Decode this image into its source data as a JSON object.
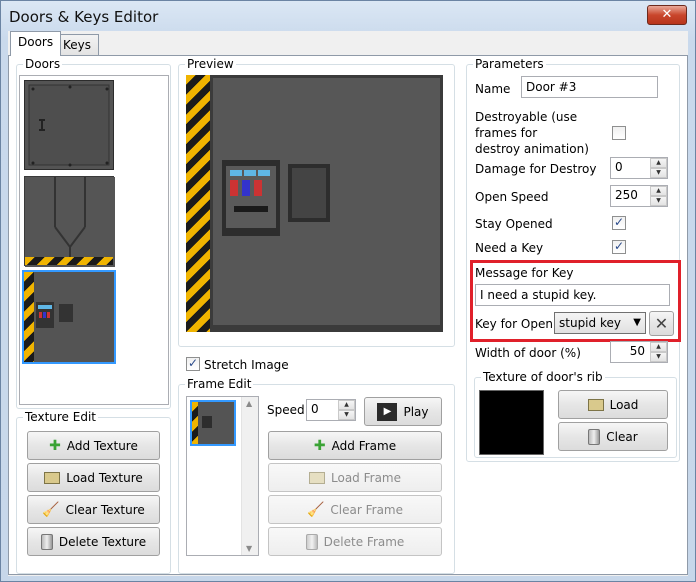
{
  "window": {
    "title": "Doors & Keys Editor",
    "close_glyph": "✕"
  },
  "tabs": [
    {
      "label": "Doors",
      "active": true
    },
    {
      "label": "Keys",
      "active": false
    }
  ],
  "doors_panel": {
    "label": "Doors",
    "door_count": 3,
    "selected_index": 2
  },
  "texture_edit": {
    "label": "Texture Edit",
    "add": "Add Texture",
    "load": "Load Texture",
    "clear": "Clear Texture",
    "delete": "Delete Texture"
  },
  "preview": {
    "label": "Preview"
  },
  "stretch_image": {
    "label": "Stretch Image",
    "checked": true
  },
  "frame_edit": {
    "label": "Frame Edit",
    "speed_label": "Speed",
    "speed_value": "0",
    "play": "Play",
    "add": "Add Frame",
    "load": "Load Frame",
    "clear": "Clear Frame",
    "delete": "Delete Frame"
  },
  "parameters": {
    "label": "Parameters",
    "name_label": "Name",
    "name_value": "Door #3",
    "destroyable_label": "Destroyable (use frames for destroy animation)",
    "destroyable_line1": "Destroyable (use",
    "destroyable_line2": "frames for",
    "destroyable_line3": "destroy animation)",
    "destroyable_checked": false,
    "damage_label": "Damage for Destroy",
    "damage_value": "0",
    "open_speed_label": "Open Speed",
    "open_speed_value": "250",
    "stay_opened_label": "Stay Opened",
    "stay_opened_checked": true,
    "need_key_label": "Need a Key",
    "need_key_checked": true,
    "message_label": "Message for Key",
    "message_value": "I need a stupid key.",
    "key_open_label": "Key for Open",
    "key_open_value": "stupid key",
    "width_label": "Width of door (%)",
    "width_value": "50"
  },
  "rib_texture": {
    "label": "Texture of door's rib",
    "load": "Load",
    "clear": "Clear"
  },
  "colors": {
    "highlight": "#e0202a",
    "selection": "#3399ff",
    "hazard_yellow": "#f0b400"
  }
}
